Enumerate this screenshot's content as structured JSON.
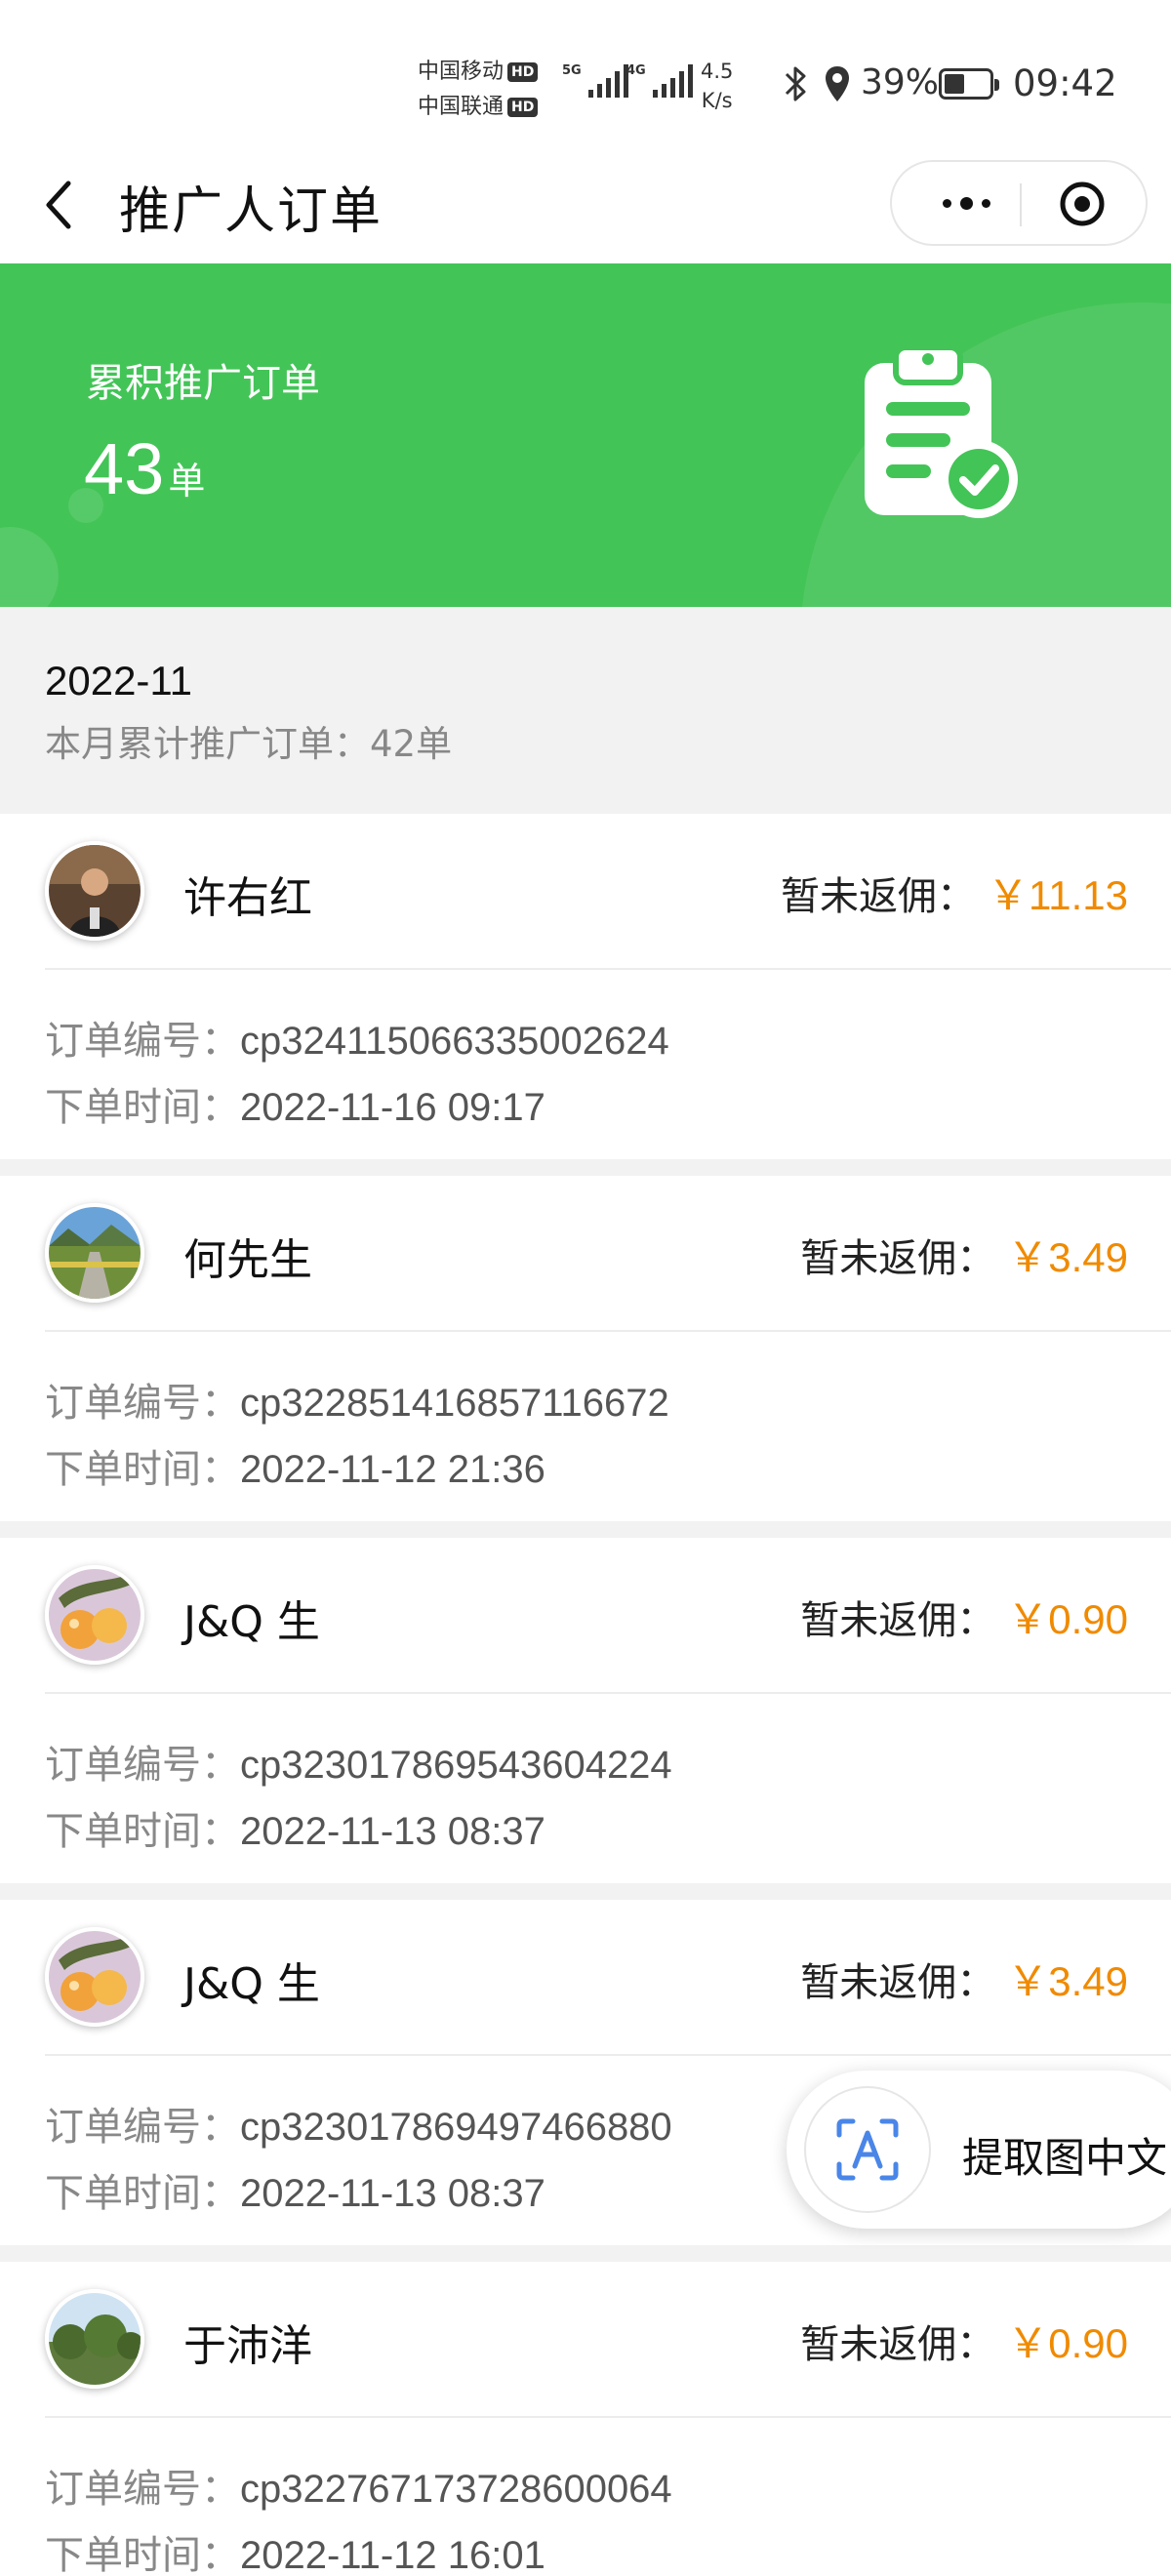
{
  "status_bar": {
    "carrier1": "中国移动",
    "carrier2": "中国联通",
    "hd_badge": "HD",
    "network1": "5G",
    "network2": "4G",
    "speed_value": "4.5",
    "speed_unit": "K/s",
    "battery_percent": "39%",
    "battery_level": 0.39,
    "time": "09:42",
    "icons": [
      "bluetooth-icon",
      "location-icon",
      "battery-icon"
    ]
  },
  "nav": {
    "title": "推广人订单",
    "icons": [
      "back-arrow-icon",
      "more-dots-icon",
      "close-target-icon"
    ]
  },
  "summary": {
    "label": "累积推广订单",
    "count": "43",
    "unit": "单",
    "icon": "clipboard-check-icon"
  },
  "month": {
    "label": "2022-11",
    "summary_text": "本月累计推广订单：42单"
  },
  "order_labels": {
    "rebate_label": "暂未返佣：",
    "order_no_label": "订单编号：",
    "order_time_label": "下单时间："
  },
  "orders": [
    {
      "name": "许右红",
      "amount": "￥11.13",
      "order_no": "cp324115066335002624",
      "time": "2022-11-16 09:17",
      "avatar": "portrait-avatar"
    },
    {
      "name": "何先生",
      "amount": "￥3.49",
      "order_no": "cp322851416857116672",
      "time": "2022-11-12 21:36",
      "avatar": "landscape-avatar"
    },
    {
      "name": "J&Q 生",
      "amount": "￥0.90",
      "order_no": "cp323017869543604224",
      "time": "2022-11-13 08:37",
      "avatar": "fruit-avatar"
    },
    {
      "name": "J&Q 生",
      "amount": "￥3.49",
      "order_no": "cp323017869497466880",
      "time": "2022-11-13 08:37",
      "avatar": "fruit-avatar"
    },
    {
      "name": "于沛洋",
      "amount": "￥0.90",
      "order_no": "cp322767173728600064",
      "time": "2022-11-12 16:01",
      "avatar": "trees-avatar"
    }
  ],
  "ocr_button": {
    "label": "提取图中文",
    "icon": "ocr-scan-icon"
  },
  "colors": {
    "brand_green": "#43c457",
    "amount_orange": "#f08a00"
  }
}
